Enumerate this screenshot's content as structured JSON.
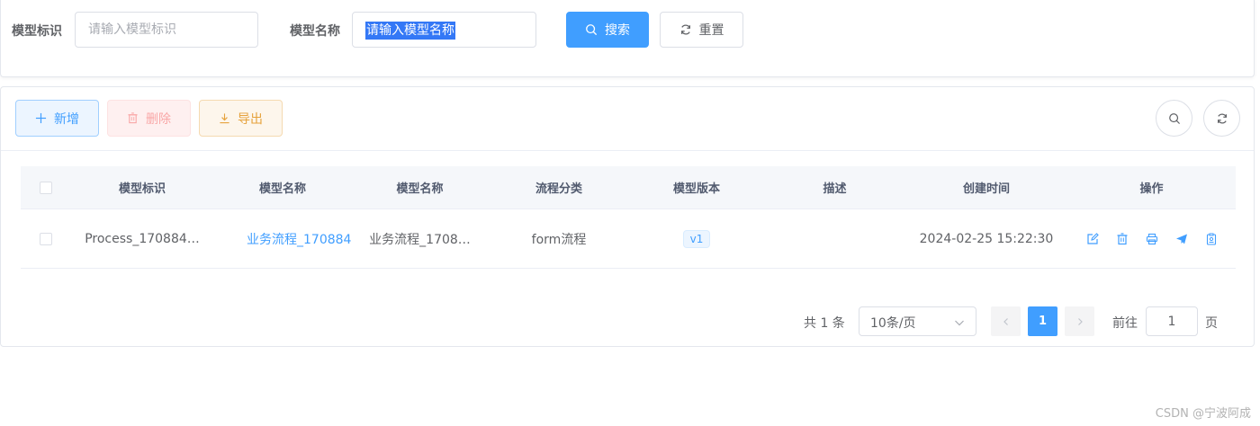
{
  "search": {
    "label_key": "模型标识",
    "placeholder_key": "请输入模型标识",
    "label_name": "模型名称",
    "placeholder_name": "请输入模型名称",
    "search_label": "搜索",
    "reset_label": "重置"
  },
  "toolbar": {
    "add_label": "新增",
    "delete_label": "删除",
    "export_label": "导出"
  },
  "table": {
    "headers": [
      "模型标识",
      "模型名称",
      "模型名称",
      "流程分类",
      "模型版本",
      "描述",
      "创建时间",
      "操作"
    ],
    "rows": [
      {
        "key": "Process_170884…",
        "name_link": "业务流程_170884:",
        "name": "业务流程_1708…",
        "category": "form流程",
        "version": "v1",
        "desc": "",
        "created": "2024-02-25 15:22:30"
      }
    ]
  },
  "pagination": {
    "total_text": "共 1 条",
    "page_size": "10条/页",
    "current_page": "1",
    "goto_label": "前往",
    "goto_value": "1",
    "page_suffix": "页"
  },
  "watermark": "CSDN @宁波阿成",
  "colors": {
    "primary": "#409eff",
    "danger_light": "#fef0f0",
    "warning": "#e6a23c"
  }
}
